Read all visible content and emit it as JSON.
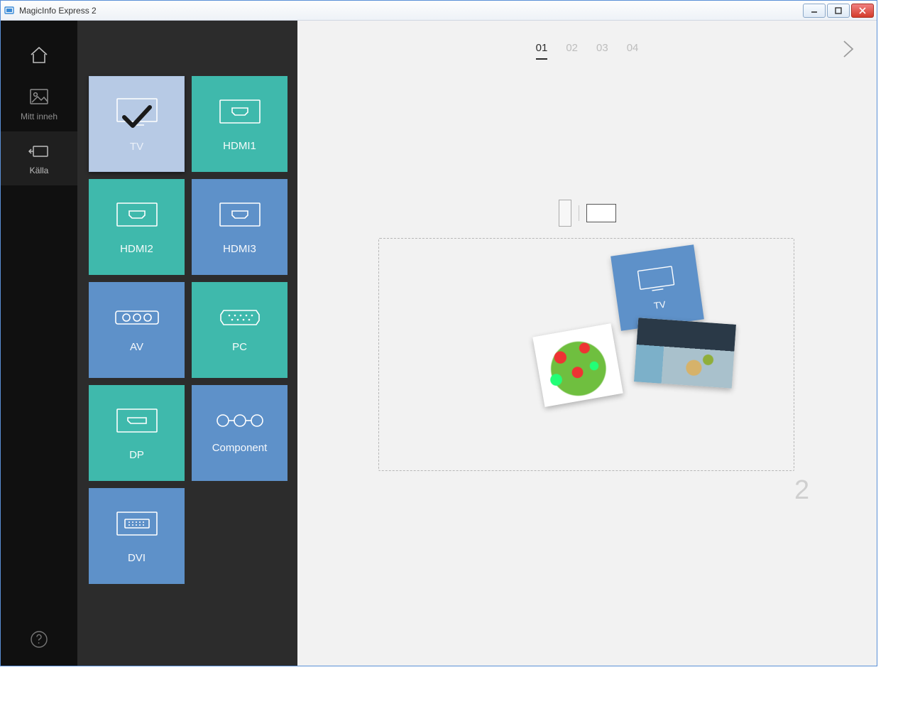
{
  "window": {
    "title": "MagicInfo Express 2"
  },
  "sidebar": {
    "items": [
      {
        "label": "Mitt inneh"
      },
      {
        "label": "Källa"
      }
    ]
  },
  "sources": {
    "tiles": [
      {
        "label": "TV",
        "selected": true
      },
      {
        "label": "HDMI1"
      },
      {
        "label": "HDMI2"
      },
      {
        "label": "HDMI3"
      },
      {
        "label": "AV"
      },
      {
        "label": "PC"
      },
      {
        "label": "DP"
      },
      {
        "label": "Component"
      },
      {
        "label": "DVI"
      }
    ]
  },
  "steps": {
    "labels": [
      "01",
      "02",
      "03",
      "04"
    ],
    "active": "01"
  },
  "canvas": {
    "slot_number": "2",
    "dropped_tv_label": "TV"
  }
}
